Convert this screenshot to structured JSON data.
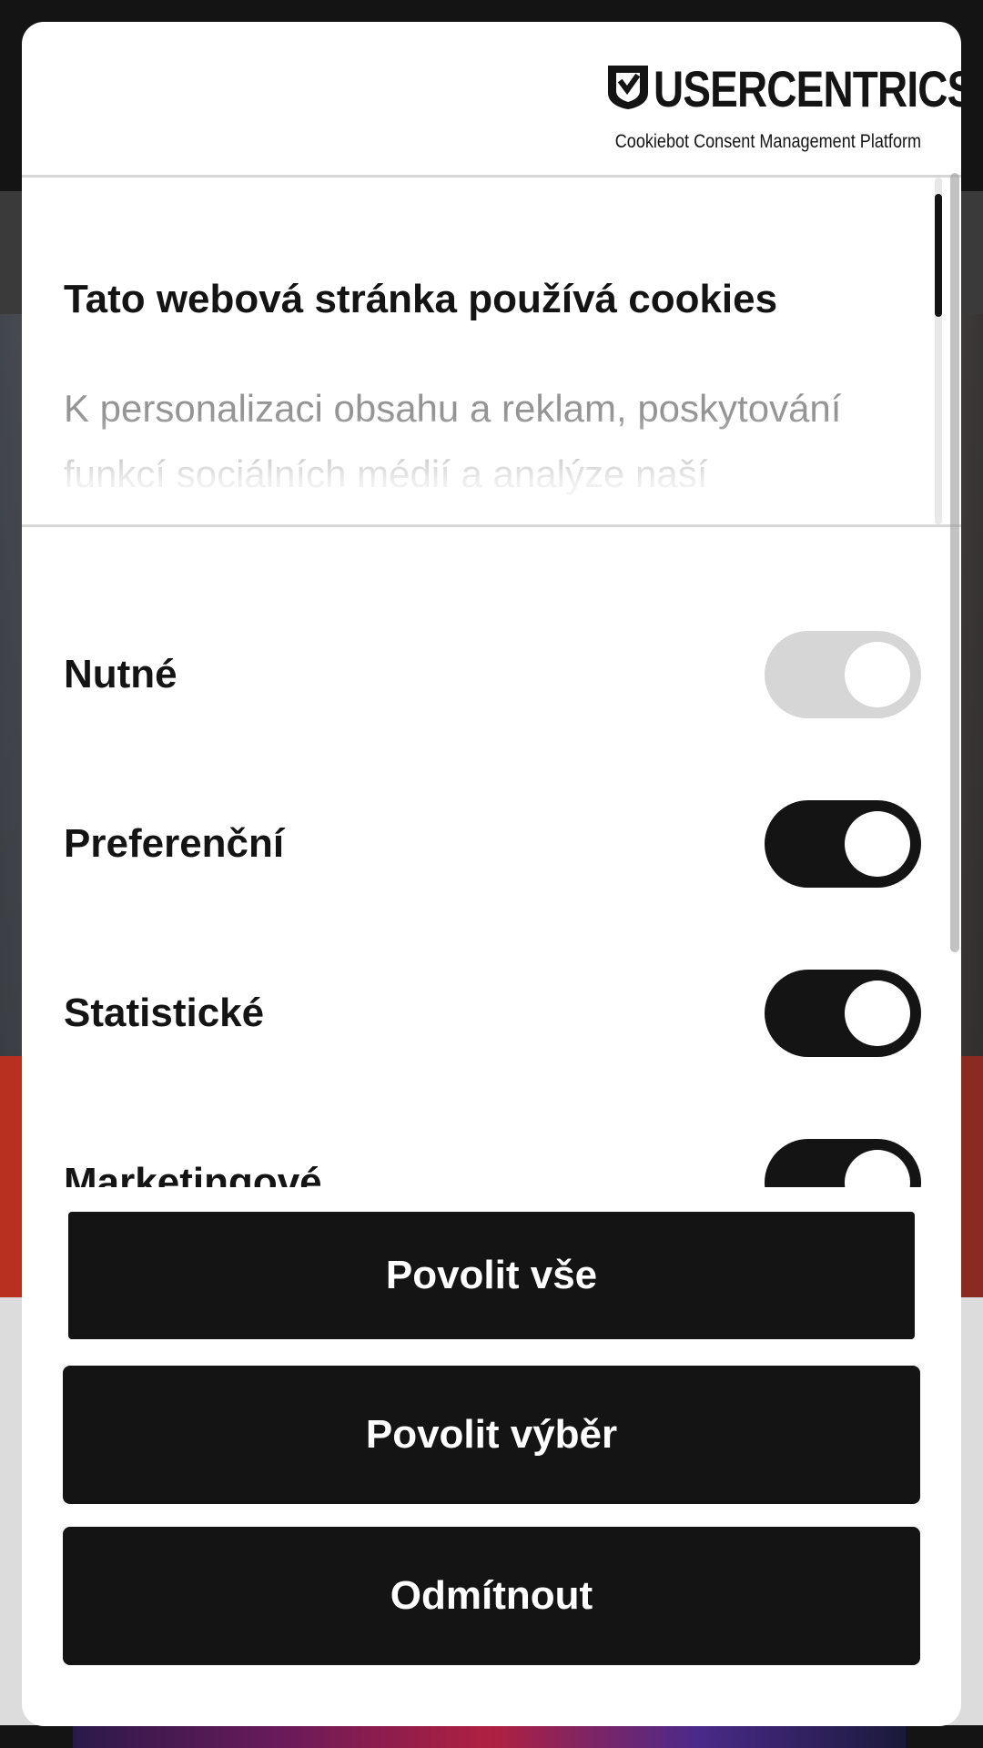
{
  "brand": {
    "name": "USERCENTRICS",
    "tagline": "Cookiebot Consent Management Platform",
    "mark": "usercentrics-shield-check-icon"
  },
  "intro": {
    "title": "Tato webová stránka používá cookies",
    "text": "K personalizaci obsahu a reklam, poskytování funkcí sociálních médií a analýze naší návštěvnosti využíváme soubory cookie."
  },
  "categories": [
    {
      "label": "Nutné",
      "enabled": true,
      "locked": true
    },
    {
      "label": "Preferenční",
      "enabled": true,
      "locked": false
    },
    {
      "label": "Statistické",
      "enabled": true,
      "locked": false
    },
    {
      "label": "Marketingové",
      "enabled": true,
      "locked": false
    }
  ],
  "buttons": {
    "allow_all": "Povolit vše",
    "allow_selection": "Povolit výběr",
    "deny": "Odmítnout"
  },
  "colors": {
    "primary": "#141414",
    "surface": "#ffffff",
    "disabled_toggle": "#d6d6d6",
    "divider": "#d6d6d6"
  }
}
